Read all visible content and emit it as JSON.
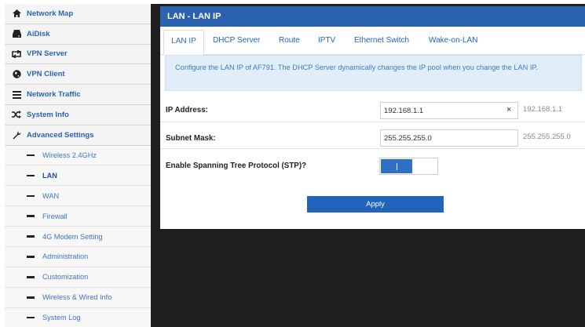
{
  "sidebar": {
    "items": [
      {
        "label": "Network Map",
        "icon": "home-icon"
      },
      {
        "label": "AiDisk",
        "icon": "disk-icon"
      },
      {
        "label": "VPN Server",
        "icon": "vpn-server-icon"
      },
      {
        "label": "VPN Client",
        "icon": "globe-icon"
      },
      {
        "label": "Network Traffic",
        "icon": "traffic-icon"
      },
      {
        "label": "System Info",
        "icon": "shuffle-icon"
      },
      {
        "label": "Advanced Settings",
        "icon": "wrench-icon"
      }
    ],
    "subitems": [
      {
        "label": "Wireless 2.4GHz"
      },
      {
        "label": "LAN",
        "active": true
      },
      {
        "label": "WAN"
      },
      {
        "label": "Firewall"
      },
      {
        "label": "4G Modem Setting"
      },
      {
        "label": "Administration"
      },
      {
        "label": "Customization"
      },
      {
        "label": "Wireless & Wired Info"
      },
      {
        "label": "System Log"
      }
    ]
  },
  "panel": {
    "title": "LAN - LAN IP",
    "tabs": [
      {
        "label": "LAN IP",
        "active": true
      },
      {
        "label": "DHCP Server"
      },
      {
        "label": "Route"
      },
      {
        "label": "IPTV"
      },
      {
        "label": "Ethernet Switch"
      },
      {
        "label": "Wake-on-LAN"
      }
    ],
    "notice": "Configure the LAN IP of AF791. The DHCP Server dynamically changes the IP pool when you change the LAN IP.",
    "ip_address": {
      "label": "IP Address:",
      "value": "192.168.1.1",
      "clear": "×",
      "hint": "192.168.1.1"
    },
    "subnet_mask": {
      "label": "Subnet Mask:",
      "value": "255.255.255.0",
      "hint": "255.255.255.0"
    },
    "stp": {
      "label": "Enable Spanning Tree Protocol (STP)?",
      "enabled": true
    },
    "apply_label": "Apply"
  },
  "colors": {
    "header": "#2b62b0",
    "accent": "#2f6fc4",
    "notice_bg": "#e1eef9",
    "link": "#2163b8"
  }
}
